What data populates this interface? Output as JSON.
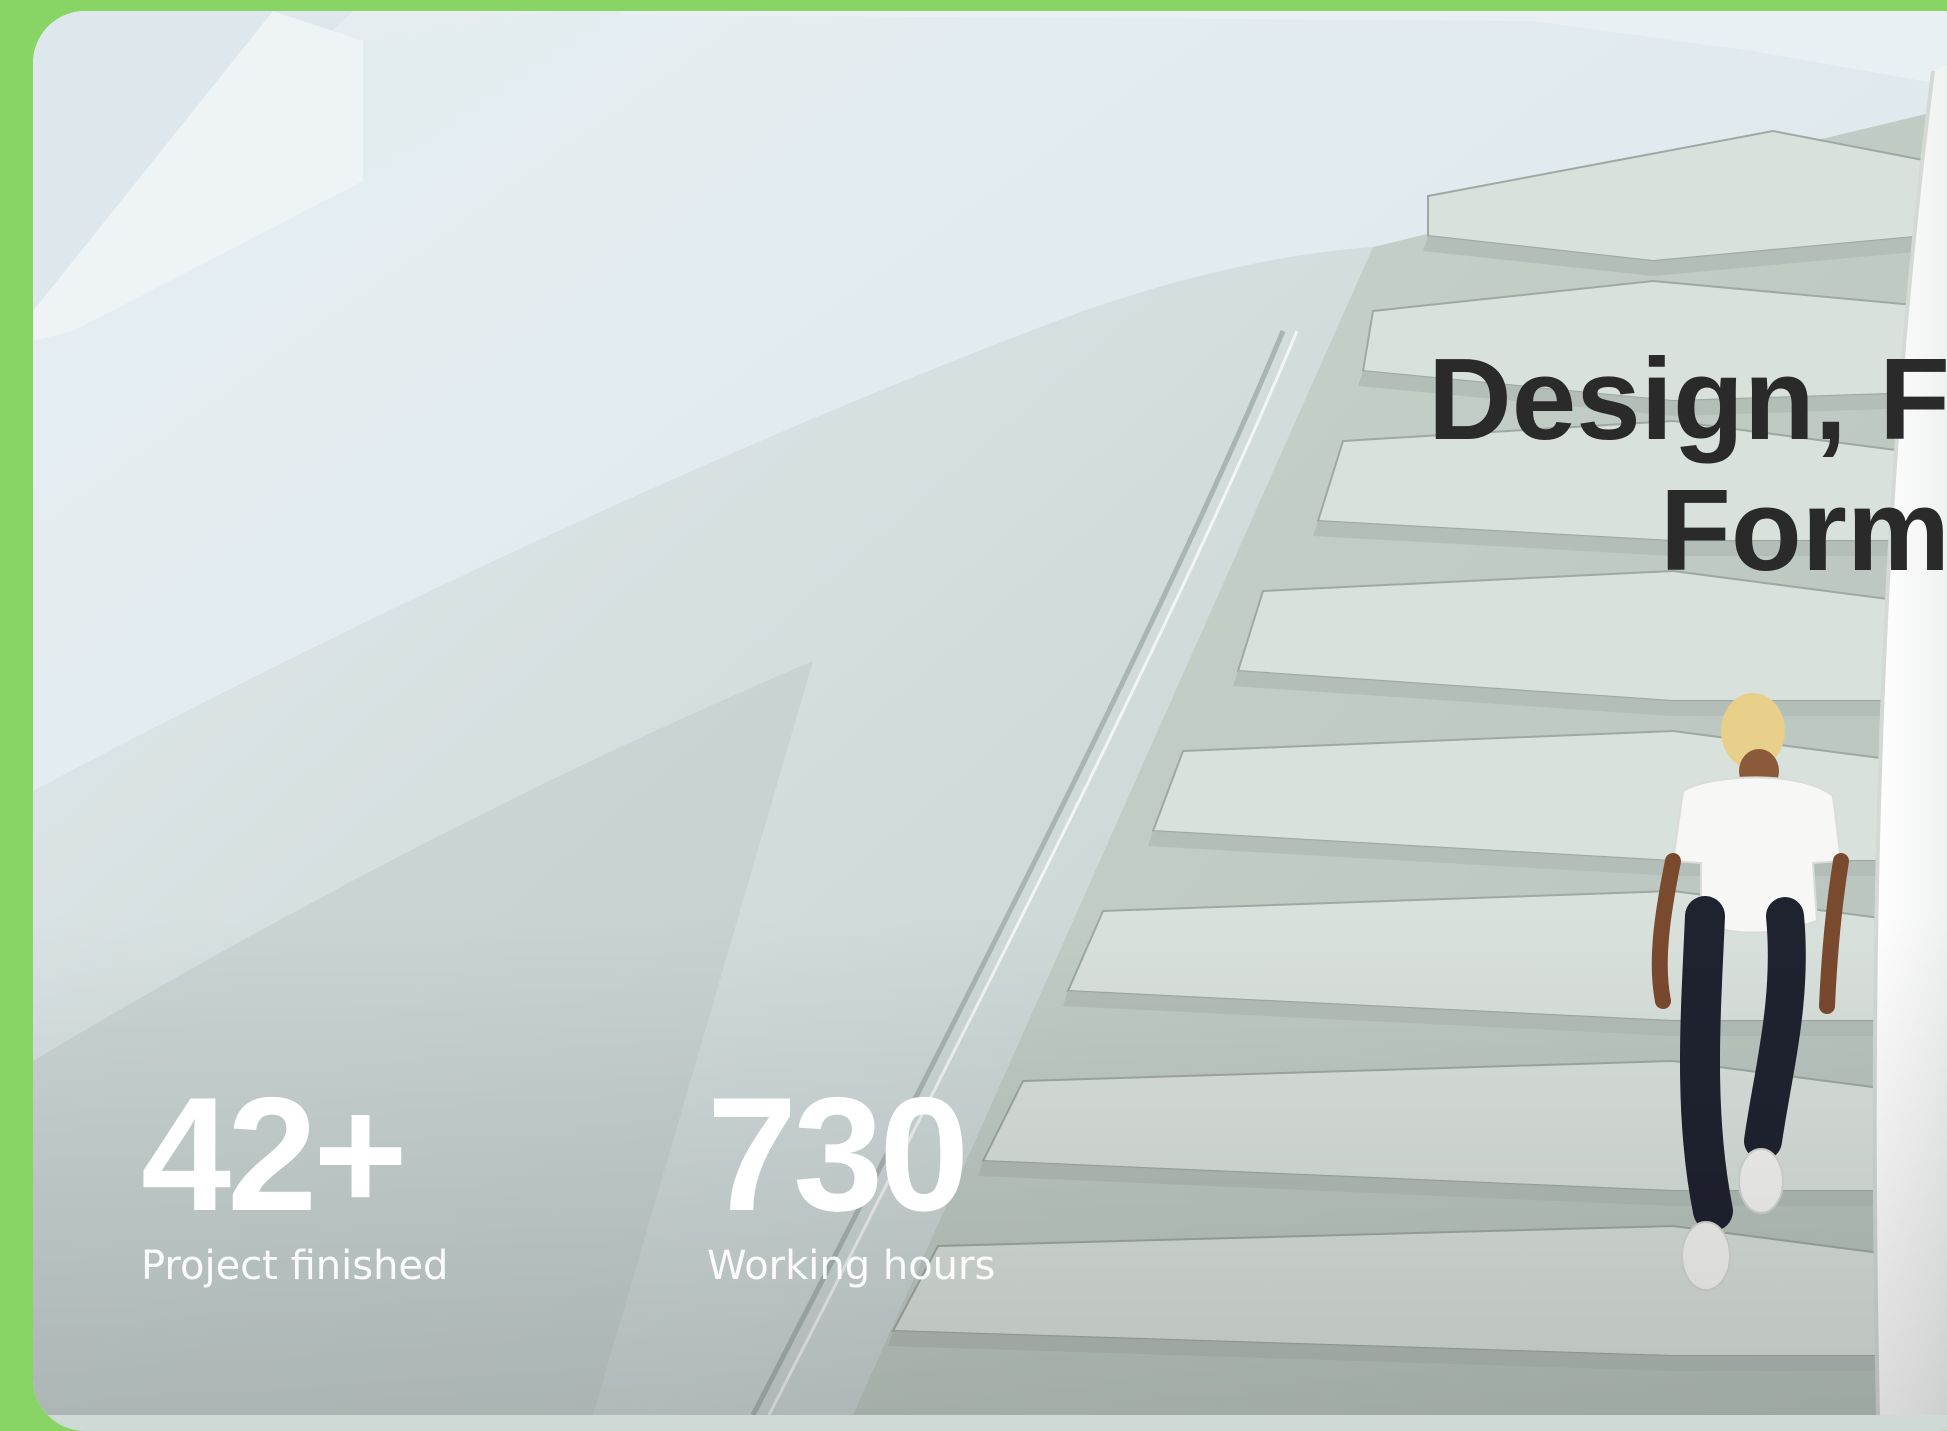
{
  "hero": {
    "headline_line1": "Design, F",
    "headline_line2": "Form",
    "stats": [
      {
        "value": "42+",
        "label": "Project finished"
      },
      {
        "value": "730",
        "label": "Working hours"
      }
    ]
  },
  "colors": {
    "frame_background": "#88d464",
    "stat_text": "#ffffff",
    "headline_text": "#2a2a2a"
  }
}
